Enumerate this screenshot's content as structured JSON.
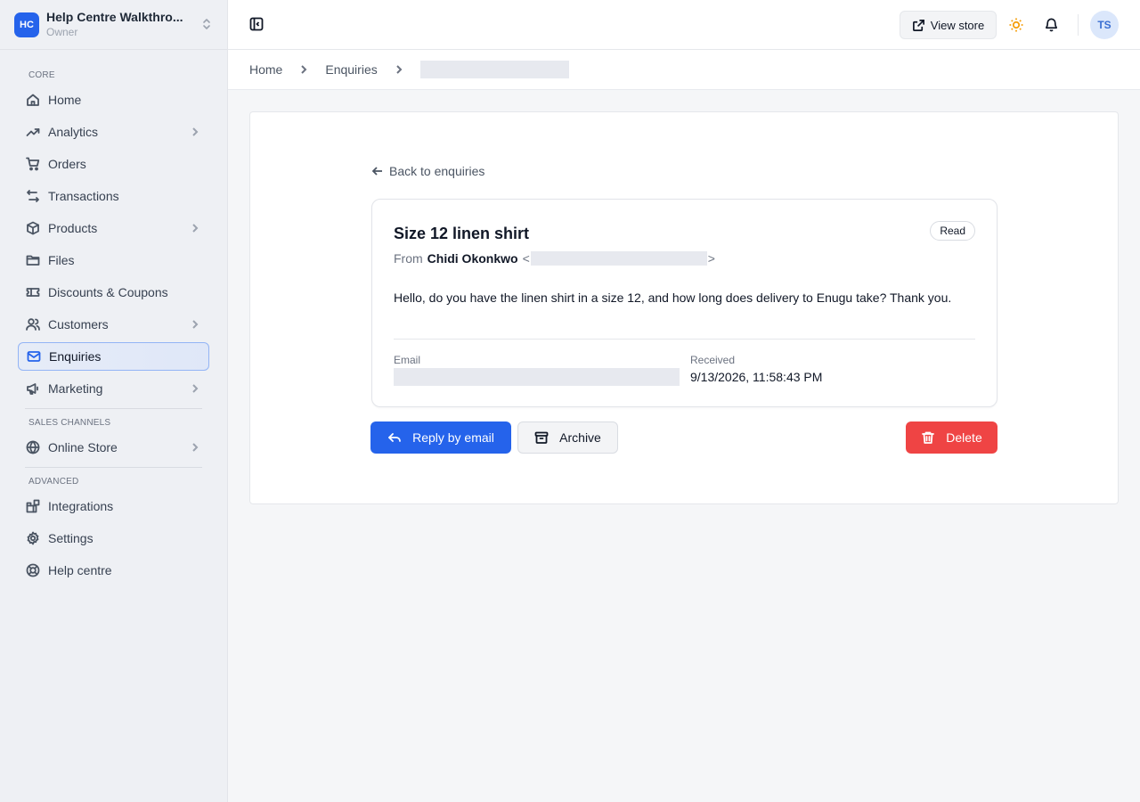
{
  "store": {
    "logo_initials": "HC",
    "name": "Help Centre Walkthro...",
    "role": "Owner"
  },
  "sidebar": {
    "sections": [
      {
        "title": "CORE",
        "items": [
          {
            "label": "Home",
            "icon": "home-icon",
            "has_children": false
          },
          {
            "label": "Analytics",
            "icon": "trending-up-icon",
            "has_children": true
          },
          {
            "label": "Orders",
            "icon": "cart-icon",
            "has_children": false
          },
          {
            "label": "Transactions",
            "icon": "arrows-exchange-icon",
            "has_children": false
          },
          {
            "label": "Products",
            "icon": "box-icon",
            "has_children": true
          },
          {
            "label": "Files",
            "icon": "folder-icon",
            "has_children": false
          },
          {
            "label": "Discounts & Coupons",
            "icon": "ticket-icon",
            "has_children": false
          },
          {
            "label": "Customers",
            "icon": "users-icon",
            "has_children": true
          },
          {
            "label": "Enquiries",
            "icon": "mail-icon",
            "has_children": false,
            "active": true
          },
          {
            "label": "Marketing",
            "icon": "megaphone-icon",
            "has_children": true
          }
        ]
      },
      {
        "title": "SALES CHANNELS",
        "items": [
          {
            "label": "Online Store",
            "icon": "globe-icon",
            "has_children": true
          }
        ]
      },
      {
        "title": "ADVANCED",
        "items": [
          {
            "label": "Integrations",
            "icon": "blocks-icon",
            "has_children": false
          },
          {
            "label": "Settings",
            "icon": "gear-icon",
            "has_children": false
          },
          {
            "label": "Help centre",
            "icon": "lifebuoy-icon",
            "has_children": false
          }
        ]
      }
    ]
  },
  "topbar": {
    "view_store_label": "View store",
    "avatar_initials": "TS"
  },
  "breadcrumb": {
    "items": [
      "Home",
      "Enquiries"
    ]
  },
  "enquiry": {
    "back_label": "Back to enquiries",
    "subject": "Size 12 linen shirt",
    "status": "Read",
    "from_prefix": "From",
    "sender_name": "Chidi Okonkwo",
    "email_open": "<",
    "email_close": ">",
    "message": "Hello, do you have the linen shirt in a size 12, and how long does delivery to Enugu take? Thank you.",
    "email_label": "Email",
    "received_label": "Received",
    "received_value": "9/13/2026, 11:58:43 PM"
  },
  "actions": {
    "reply_label": "Reply by email",
    "archive_label": "Archive",
    "delete_label": "Delete"
  },
  "colors": {
    "accent": "#2563eb",
    "danger": "#ef4444",
    "warning": "#f59e0b"
  }
}
